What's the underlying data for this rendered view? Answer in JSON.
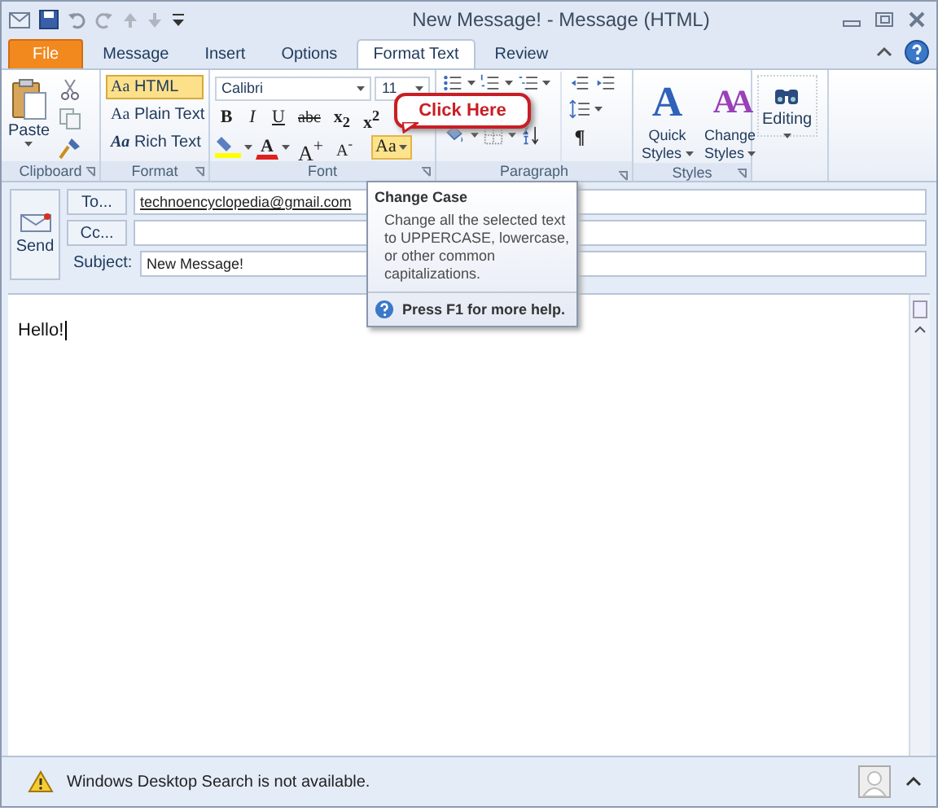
{
  "window": {
    "title": "New Message! - Message (HTML)"
  },
  "tabs": [
    {
      "label": "File",
      "kind": "file",
      "selected": false
    },
    {
      "label": "Message",
      "kind": "tab",
      "selected": false
    },
    {
      "label": "Insert",
      "kind": "tab",
      "selected": false
    },
    {
      "label": "Options",
      "kind": "tab",
      "selected": false
    },
    {
      "label": "Format Text",
      "kind": "tab",
      "selected": true
    },
    {
      "label": "Review",
      "kind": "tab",
      "selected": false
    }
  ],
  "clipboard": {
    "label": "Clipboard",
    "paste": "Paste"
  },
  "format": {
    "label": "Format",
    "options": [
      {
        "label": "HTML",
        "glyph": "Aa",
        "selected": true
      },
      {
        "label": "Plain Text",
        "glyph": "Aa",
        "selected": false
      },
      {
        "label": "Rich Text",
        "glyph": "Aa",
        "selected": false
      }
    ]
  },
  "font": {
    "label": "Font",
    "name": "Calibri",
    "size_entry": "11",
    "style_buttons": [
      "B",
      "I",
      "U",
      "abc",
      "x$_{2}$",
      "x$^{2}$"
    ],
    "color_glyph": "A",
    "grow": "A$^{+}$",
    "shrink": "A$^{-}$",
    "change_case": {
      "glyph": "Aa",
      "hovered": true
    }
  },
  "paragraph": {
    "label": "Paragraph",
    "pilcrow": "¶"
  },
  "styles": {
    "label": "Styles",
    "buttons": [
      {
        "label": "Quick Styles",
        "glyph": "A"
      },
      {
        "label": "Change Styles",
        "glyph": "AA"
      }
    ]
  },
  "editing": {
    "label": "Editing"
  },
  "callout": {
    "text": "Click Here"
  },
  "tooltip": {
    "title": "Change Case",
    "description": "Change all the selected text to UPPERCASE, lowercase, or other common capitalizations.",
    "help": "Press F1 for more help."
  },
  "header": {
    "send": "Send",
    "fields": [
      {
        "kind": "button",
        "label": "To...",
        "value": "technoencyclopedia@gmail.com"
      },
      {
        "kind": "button",
        "label": "Cc..."
      },
      {
        "kind": "label",
        "label": "Subject:",
        "value": "New Message!"
      }
    ]
  },
  "body": {
    "text": "Hello!"
  },
  "status_bar": {
    "message": "Windows Desktop Search is not available."
  }
}
